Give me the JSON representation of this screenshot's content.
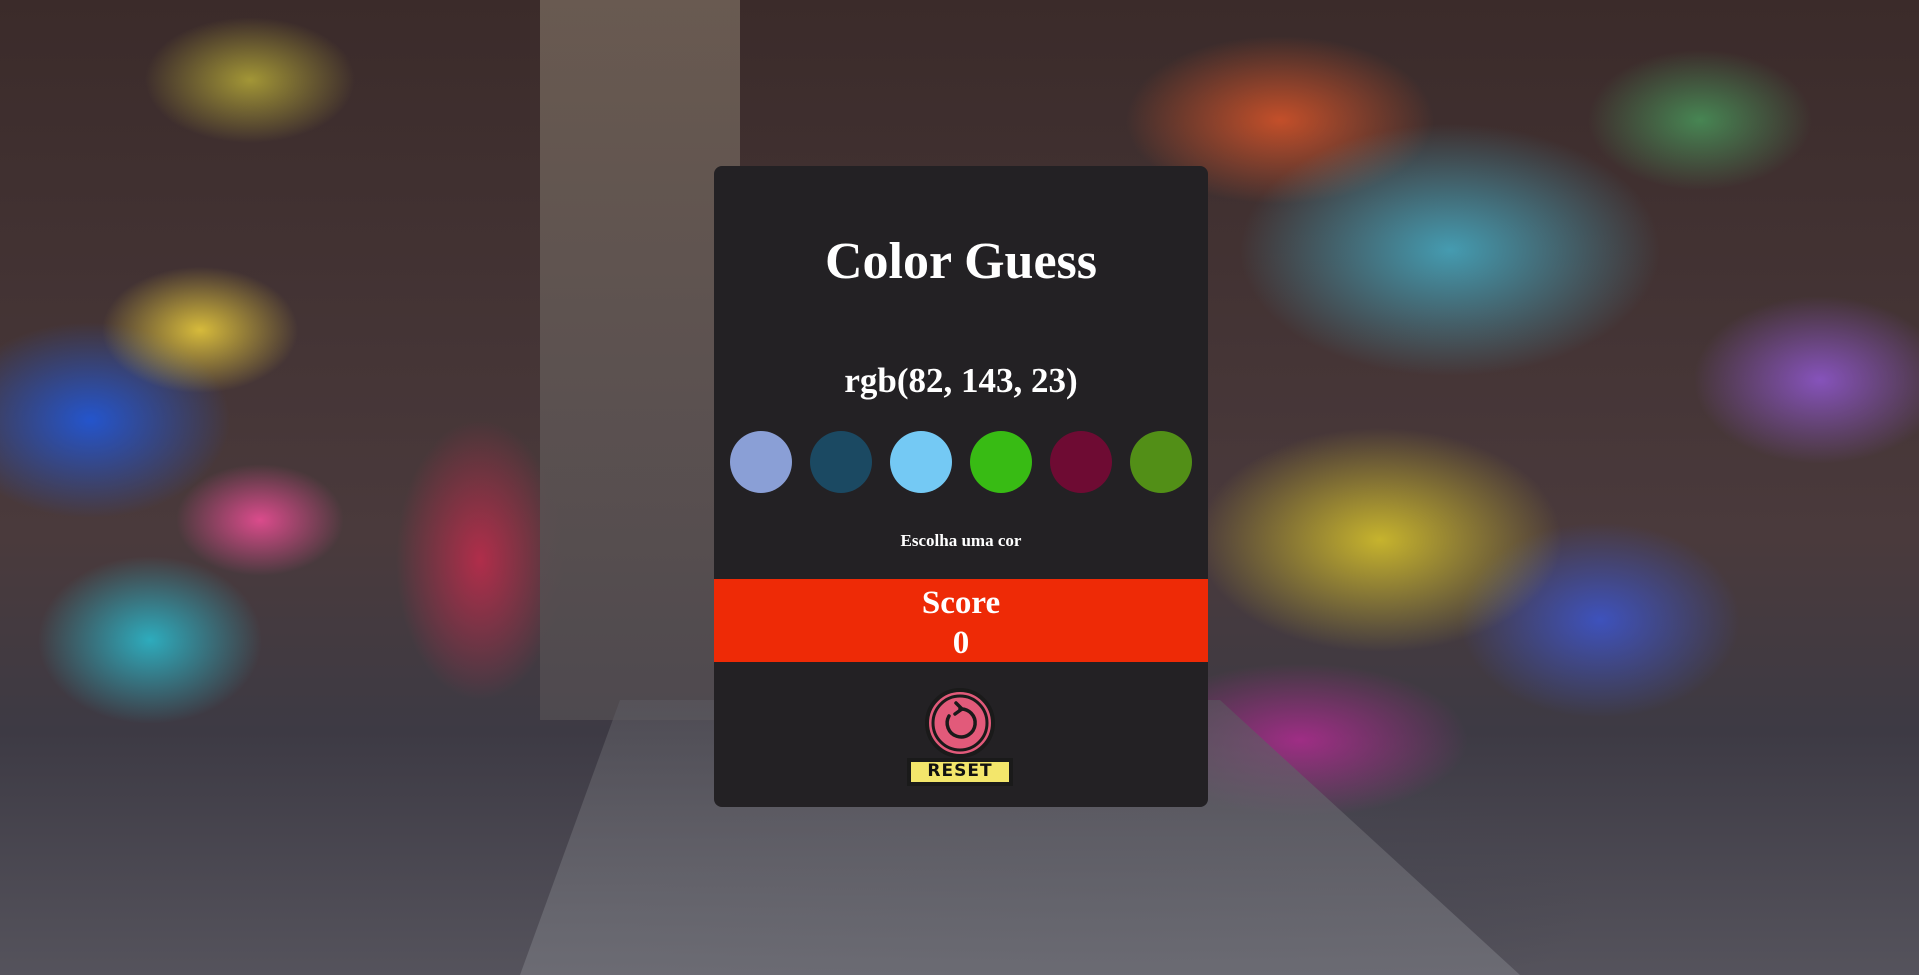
{
  "game": {
    "title": "Color Guess",
    "target_rgb": "rgb(82, 143, 23)",
    "status": "Escolha uma cor",
    "score_label": "Score",
    "score_value": "0",
    "reset_label": "RESET"
  },
  "swatches": [
    {
      "color": "#8a9fd6"
    },
    {
      "color": "#1b4962"
    },
    {
      "color": "#74c9f4"
    },
    {
      "color": "#38bb14"
    },
    {
      "color": "#6e0b33"
    },
    {
      "color": "#528f17"
    }
  ],
  "colors": {
    "card_background": "#232124",
    "score_background": "#ee2a06",
    "text": "#ffffff",
    "reset_knob": "#e25a7a",
    "reset_plate": "#f3e66b"
  },
  "icons": {
    "reset": "circular-arrow-reset-icon"
  }
}
